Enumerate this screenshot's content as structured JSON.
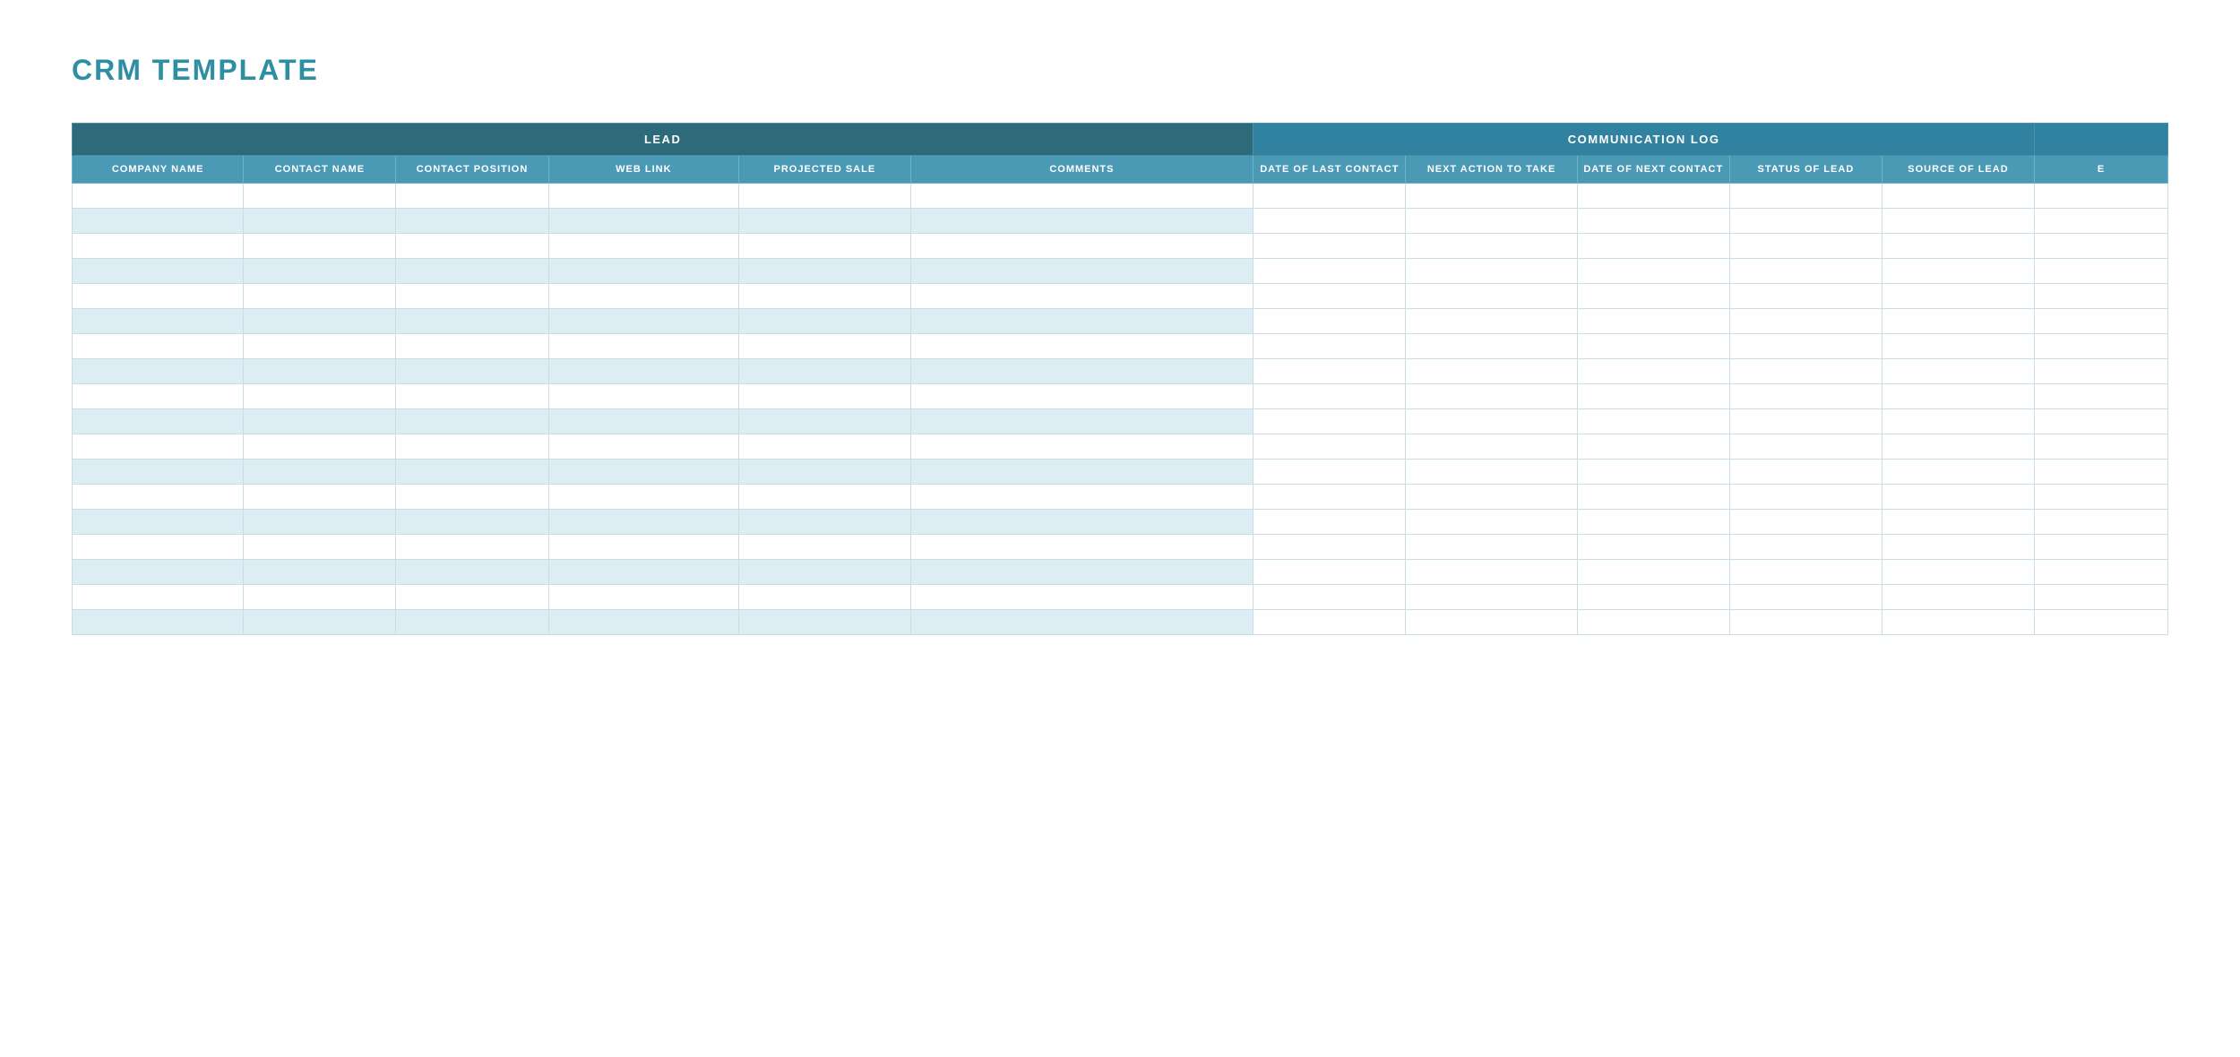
{
  "title": "CRM TEMPLATE",
  "groups": [
    {
      "label": "LEAD",
      "colspan": 6,
      "class": "lead-group"
    },
    {
      "label": "COMMUNICATION LOG",
      "colspan": 5,
      "class": "comm-group"
    },
    {
      "label": "",
      "colspan": 1,
      "class": "extra-group"
    }
  ],
  "columns": [
    {
      "id": "company",
      "label": "COMPANY\nNAME"
    },
    {
      "id": "contact-name",
      "label": "CONTACT\nNAME"
    },
    {
      "id": "contact-pos",
      "label": "CONTACT\nPOSITION"
    },
    {
      "id": "web",
      "label": "WEB LINK"
    },
    {
      "id": "proj-sale",
      "label": "PROJECTED\nSALE"
    },
    {
      "id": "comments",
      "label": "COMMENTS"
    },
    {
      "id": "date-last",
      "label": "DATE OF\nLAST\nCONTACT"
    },
    {
      "id": "next-action",
      "label": "NEXT ACTION\nTO TAKE"
    },
    {
      "id": "date-next",
      "label": "DATE OF\nNEXT\nCONTACT"
    },
    {
      "id": "status",
      "label": "STATUS OF\nLEAD"
    },
    {
      "id": "source",
      "label": "SOURCE OF\nLEAD"
    },
    {
      "id": "extra",
      "label": "E"
    }
  ],
  "rows": 18
}
